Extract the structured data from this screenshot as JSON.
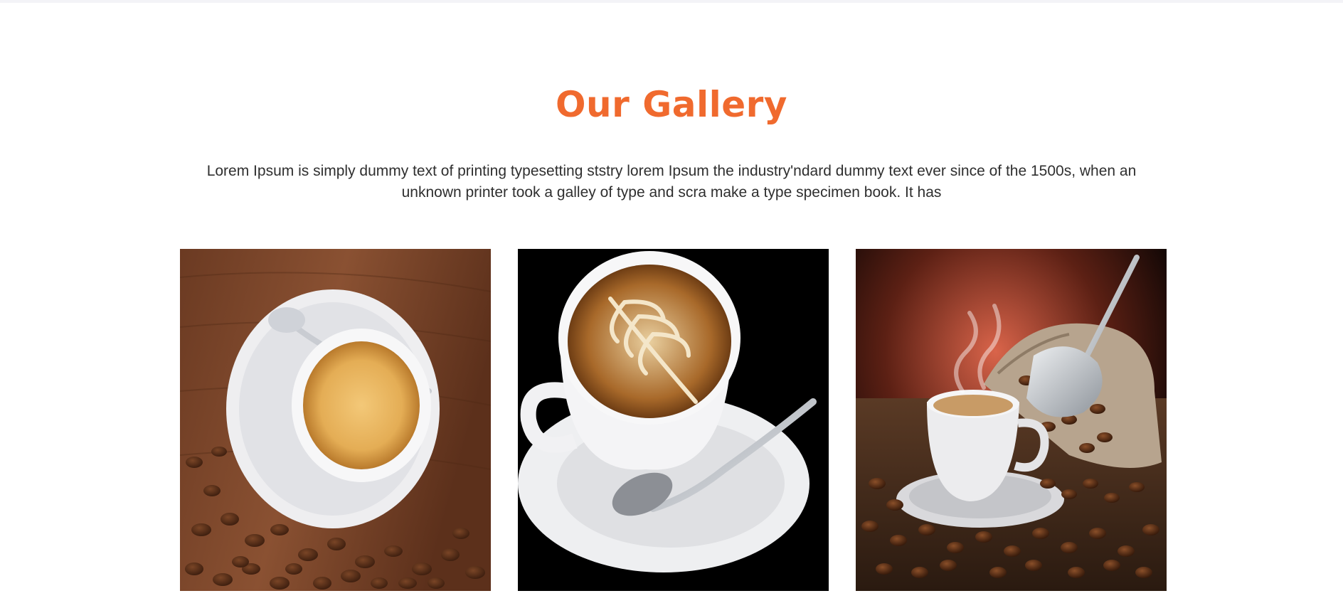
{
  "gallery": {
    "title": "Our Gallery",
    "intro": "Lorem Ipsum is simply dummy text of printing typesetting ststry lorem Ipsum the industry'ndard dummy text ever since of the 1500s, when an unknown printer took a galley of type and scra make a type specimen book. It has",
    "accent_color": "#f06a2e",
    "photos": [
      {
        "subject": "espresso cup with spoon on saucer, wooden table and coffee beans"
      },
      {
        "subject": "latte art cup with spoon on black background"
      },
      {
        "subject": "steaming coffee cup with beans, burlap sack and metal scoop"
      }
    ]
  }
}
